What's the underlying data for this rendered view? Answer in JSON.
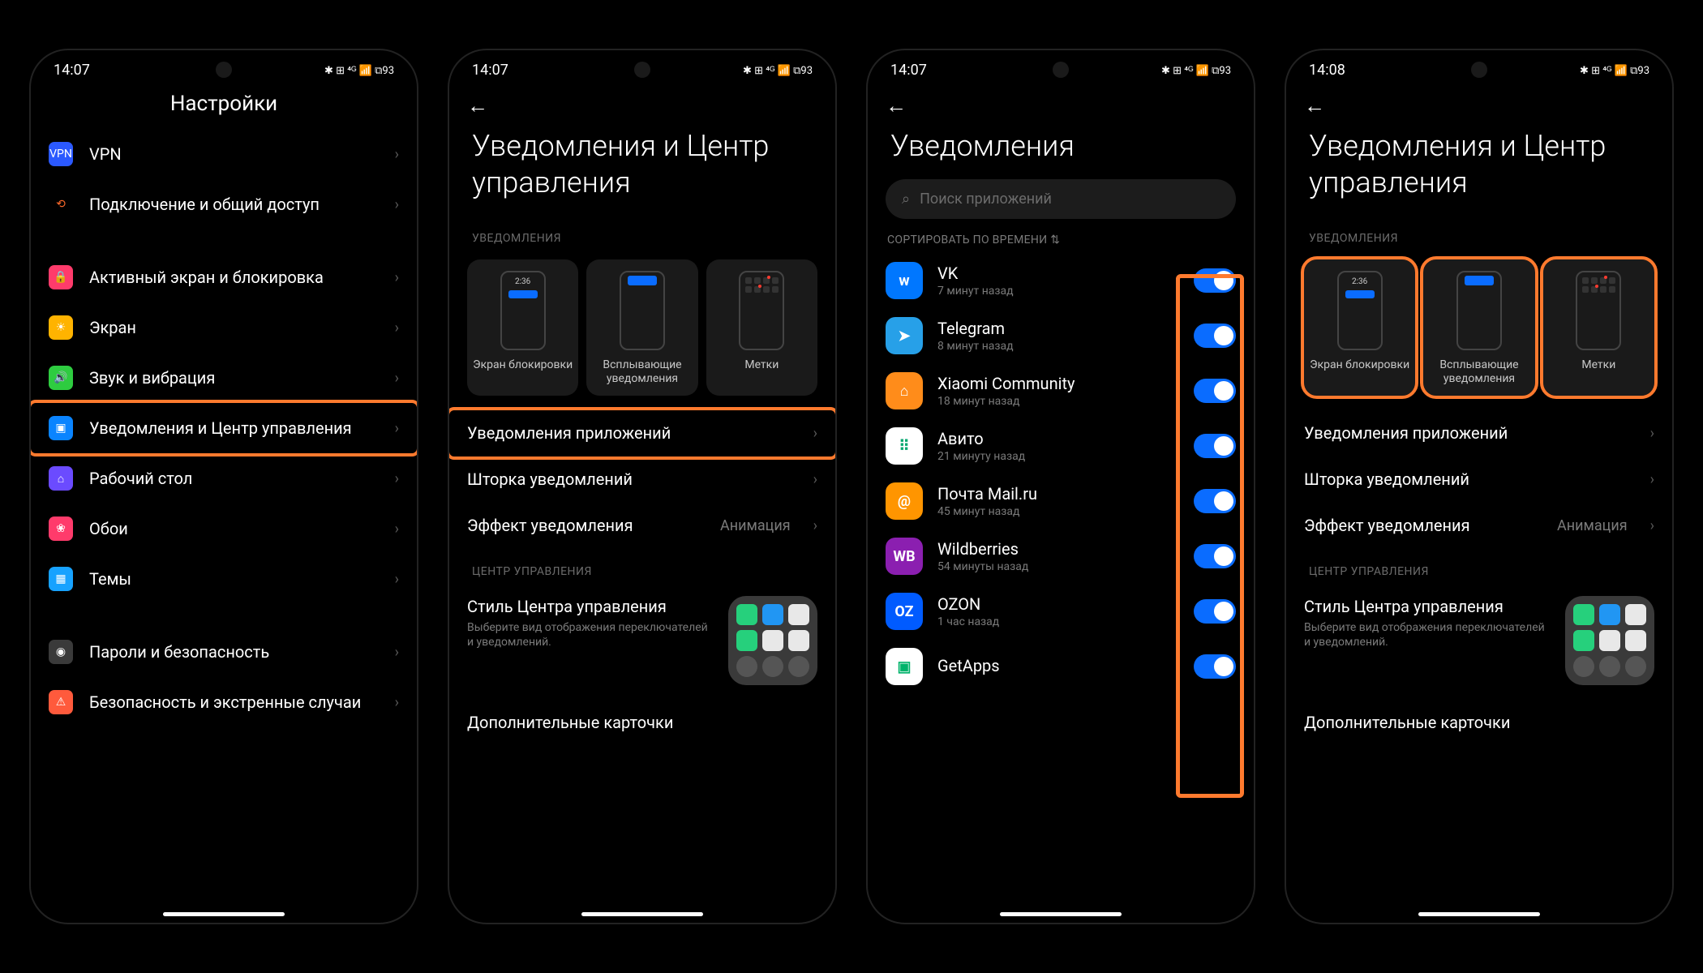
{
  "statusbar": {
    "time1": "14:07",
    "time4": "14:08",
    "icons": "✱ ⊞ ⁴ᴳ 📶 ⧉93"
  },
  "screen1": {
    "title": "Настройки",
    "items": [
      {
        "icon": "VPN",
        "bg": "#2b59ff",
        "label": "VPN"
      },
      {
        "icon": "⟲",
        "bg": "#000",
        "fg": "#ff6a2b",
        "label": "Подключение и общий доступ"
      }
    ],
    "items2": [
      {
        "icon": "🔒",
        "bg": "#ff3b6b",
        "label": "Активный экран и блокировка"
      },
      {
        "icon": "☀",
        "bg": "#ffb300",
        "label": "Экран"
      },
      {
        "icon": "🔊",
        "bg": "#2ecc40",
        "label": "Звук и вибрация"
      },
      {
        "icon": "▣",
        "bg": "#0a84ff",
        "label": "Уведомления и Центр управления",
        "hl": true
      },
      {
        "icon": "⌂",
        "bg": "#6b4bff",
        "label": "Рабочий стол"
      },
      {
        "icon": "❀",
        "bg": "#ff3b6b",
        "label": "Обои"
      },
      {
        "icon": "▦",
        "bg": "#17a2ff",
        "label": "Темы"
      }
    ],
    "items3": [
      {
        "icon": "◉",
        "bg": "#3a3a3a",
        "label": "Пароли и безопасность"
      },
      {
        "icon": "⚠",
        "bg": "#ff5a3c",
        "label": "Безопасность и экстренные случаи"
      }
    ]
  },
  "screen2": {
    "title": "Уведомления и Центр управления",
    "sec_notif": "УВЕДОМЛЕНИЯ",
    "tiles": [
      {
        "label": "Экран блокировки",
        "variant": "lock",
        "mini_time": "2:36"
      },
      {
        "label": "Всплывающие уведомления",
        "variant": "float"
      },
      {
        "label": "Метки",
        "variant": "grid"
      }
    ],
    "rows": [
      {
        "label": "Уведомления приложений",
        "hl": true
      },
      {
        "label": "Шторка уведомлений"
      },
      {
        "label": "Эффект уведомления",
        "value": "Анимация"
      }
    ],
    "sec_cc": "ЦЕНТР УПРАВЛЕНИЯ",
    "cc_title": "Стиль Центра управления",
    "cc_desc": "Выберите вид отображения переключателей и уведомлений.",
    "extra": "Дополнительные карточки"
  },
  "screen3": {
    "title": "Уведомления",
    "search": "Поиск приложений",
    "sort": "СОРТИРОВАТЬ ПО ВРЕМЕНИ  ⇅",
    "apps": [
      {
        "name": "VK",
        "time": "7 минут назад",
        "bg": "#0077ff",
        "txt": "w"
      },
      {
        "name": "Telegram",
        "time": "8 минут назад",
        "bg": "#27a0e8",
        "txt": "➤"
      },
      {
        "name": "Xiaomi Community",
        "time": "18 минут назад",
        "bg": "#ff8c1a",
        "txt": "⌂"
      },
      {
        "name": "Авито",
        "time": "21 минуту назад",
        "bg": "#ffffff",
        "txt": "⠿",
        "fg": "#03a76f"
      },
      {
        "name": "Почта Mail.ru",
        "time": "45 минут назад",
        "bg": "#ff9500",
        "txt": "@"
      },
      {
        "name": "Wildberries",
        "time": "54 минуты назад",
        "bg": "#8b1fb0",
        "txt": "WB"
      },
      {
        "name": "OZON",
        "time": "1 час назад",
        "bg": "#005bff",
        "txt": "OZ"
      },
      {
        "name": "GetApps",
        "time": "",
        "bg": "#ffffff",
        "txt": "▣",
        "fg": "#00b36b"
      }
    ]
  },
  "screen4_tiles_hl": true
}
